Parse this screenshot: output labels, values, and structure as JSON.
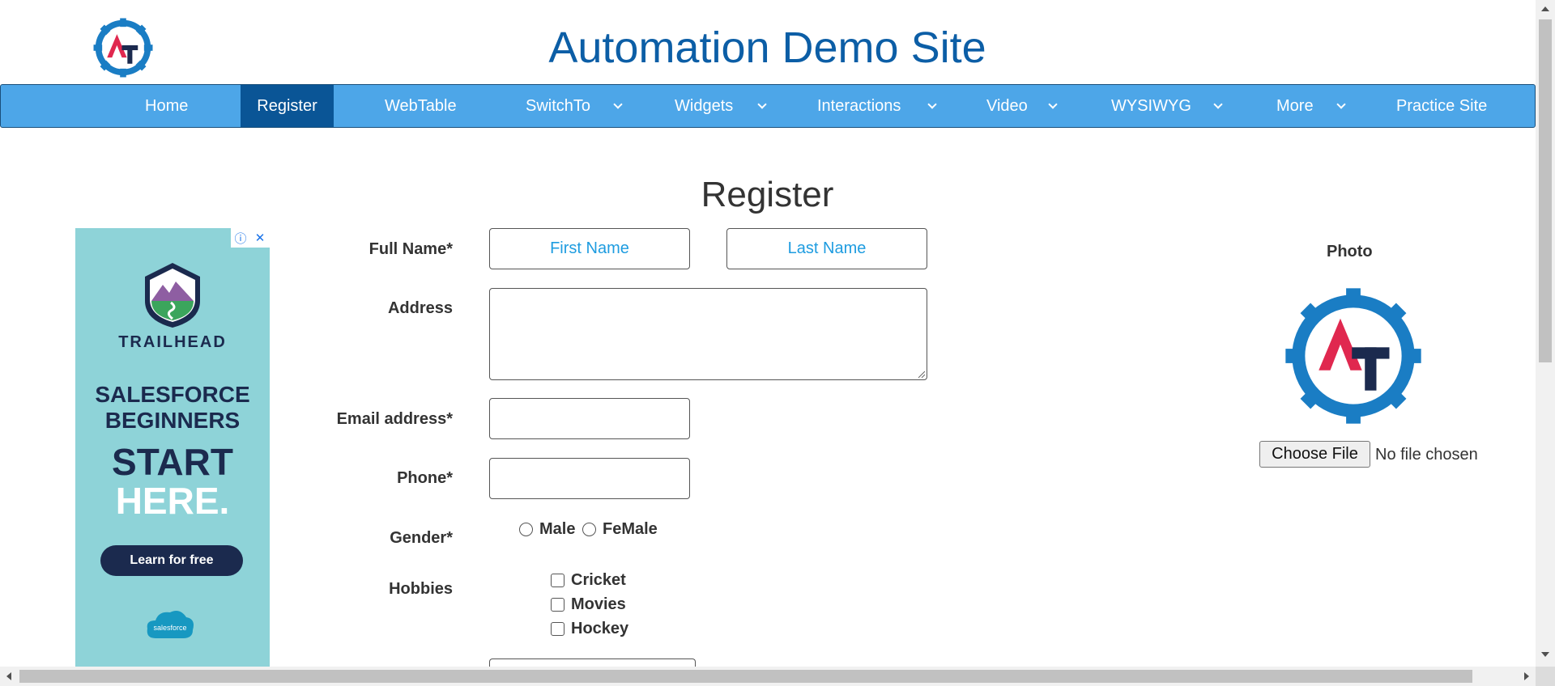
{
  "header": {
    "title": "Automation Demo Site"
  },
  "nav": {
    "items": [
      {
        "label": "Home",
        "dropdown": false
      },
      {
        "label": "Register",
        "dropdown": false,
        "active": true
      },
      {
        "label": "WebTable",
        "dropdown": false
      },
      {
        "label": "SwitchTo",
        "dropdown": true
      },
      {
        "label": "Widgets",
        "dropdown": true
      },
      {
        "label": "Interactions",
        "dropdown": true
      },
      {
        "label": "Video",
        "dropdown": true
      },
      {
        "label": "WYSIWYG",
        "dropdown": true
      },
      {
        "label": "More",
        "dropdown": true
      },
      {
        "label": "Practice Site",
        "dropdown": false
      }
    ]
  },
  "page": {
    "heading": "Register"
  },
  "ad": {
    "brand": "TRAILHEAD",
    "line1": "SALESFORCE",
    "line2": "BEGINNERS",
    "line3": "START",
    "line4": "HERE.",
    "cta": "Learn for free",
    "footer_logo": "salesforce"
  },
  "form": {
    "full_name_label": "Full Name*",
    "first_name_placeholder": "First Name",
    "last_name_placeholder": "Last Name",
    "address_label": "Address",
    "email_label": "Email address*",
    "phone_label": "Phone*",
    "gender_label": "Gender*",
    "gender_options": [
      "Male",
      "FeMale"
    ],
    "hobbies_label": "Hobbies",
    "hobbies": [
      "Cricket",
      "Movies",
      "Hockey"
    ]
  },
  "photo": {
    "label": "Photo",
    "button": "Choose File",
    "status": "No file chosen"
  },
  "colors": {
    "title": "#0c5ea6",
    "nav_bg": "#4da6e8",
    "nav_active": "#0a5596",
    "placeholder": "#1e9ce0",
    "ad_bg": "#8ed3d8"
  }
}
